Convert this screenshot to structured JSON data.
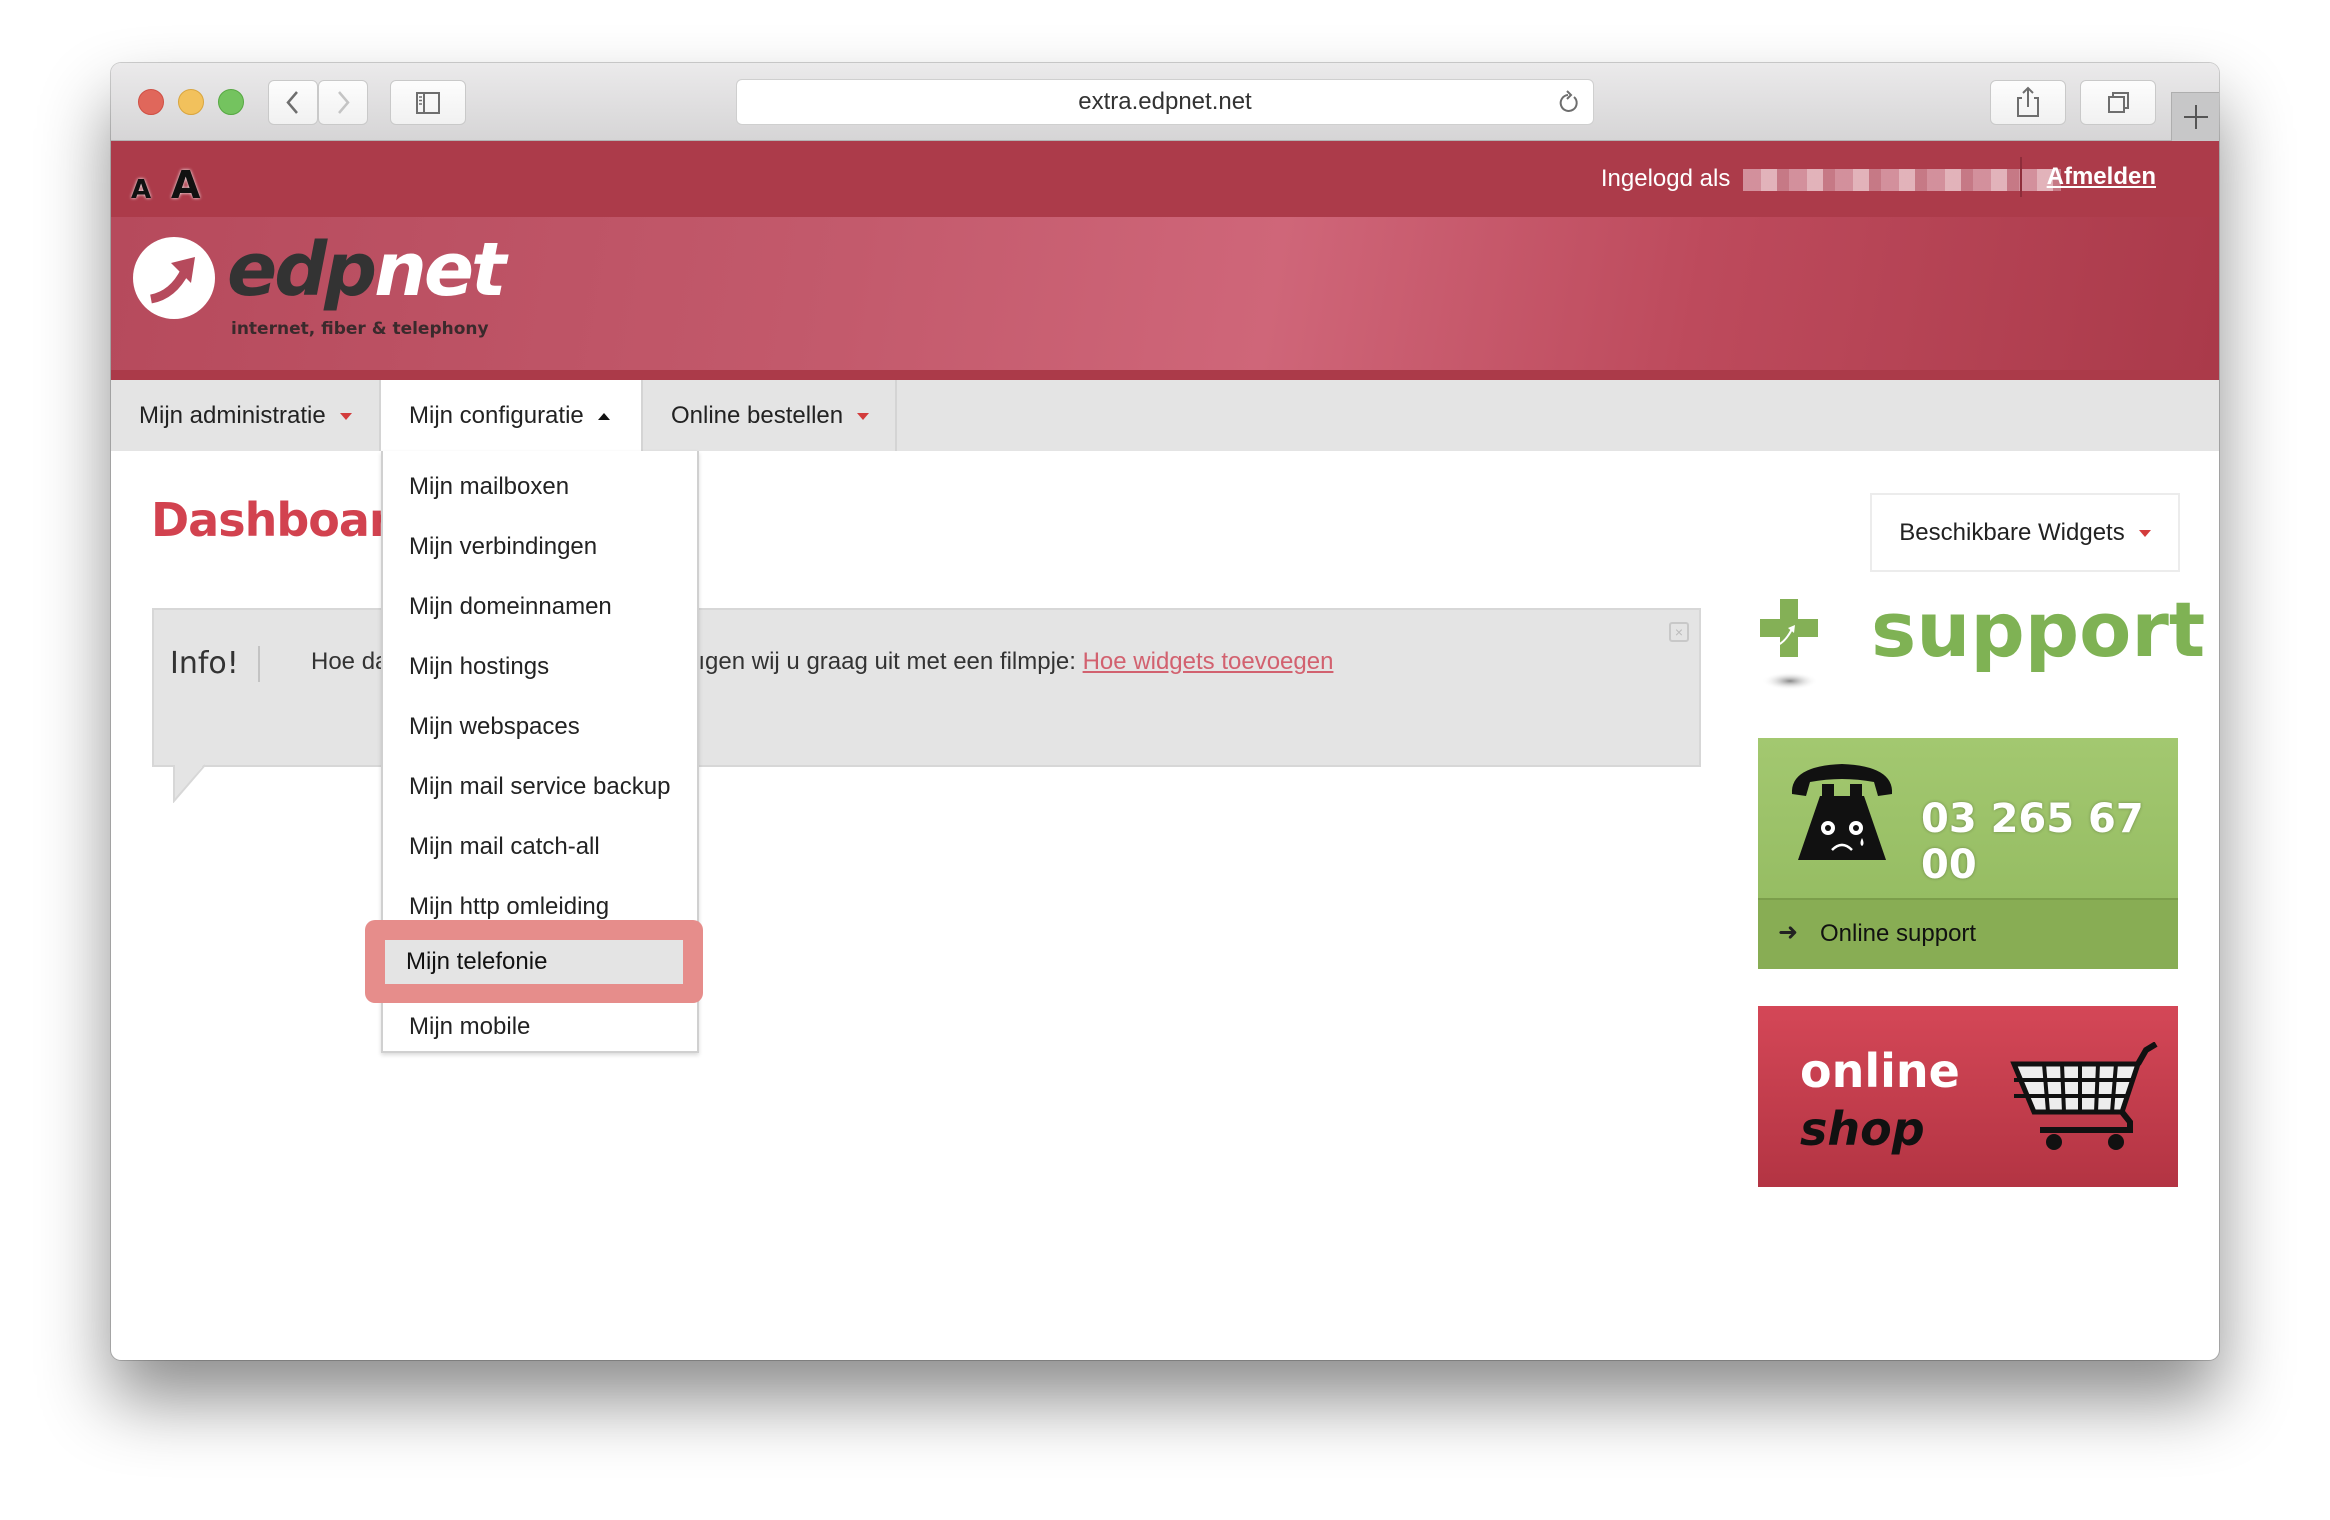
{
  "browser": {
    "url": "extra.edpnet.net",
    "traffic_lights": {
      "close": "#e0675b",
      "minimize": "#f2c15c",
      "zoom": "#74c35f"
    },
    "icons": [
      "back-icon",
      "forward-icon",
      "sidebar-icon",
      "reload-icon",
      "share-icon",
      "tabs-icon",
      "new-tab-icon"
    ]
  },
  "topbar": {
    "font_small": "A",
    "font_large": "A",
    "logged_in_label": "Ingelogd als",
    "logout": "Afmelden"
  },
  "header": {
    "logo_part1": "edp",
    "logo_part2": "net",
    "tagline": "internet, fiber & telephony"
  },
  "nav": {
    "tabs": [
      {
        "label": "Mijn administratie",
        "state": "closed"
      },
      {
        "label": "Mijn configuratie",
        "state": "open"
      },
      {
        "label": "Online bestellen",
        "state": "closed"
      }
    ]
  },
  "dropdown": {
    "items": [
      "Mijn mailboxen",
      "Mijn verbindingen",
      "Mijn domeinnamen",
      "Mijn hostings",
      "Mijn webspaces",
      "Mijn mail service backup",
      "Mijn mail catch-all",
      "Mijn http omleiding",
      "Mijn telefonie",
      "Mijn mobile"
    ],
    "highlighted": "Mijn telefonie"
  },
  "main": {
    "title": "Dashboard",
    "info": {
      "label": "Info!",
      "text_visible_start": "Hoe da",
      "text_visible_end": "ıgen wij u graag uit met een filmpje: ",
      "link": "Hoe widgets toevoegen"
    }
  },
  "sidebar": {
    "widgets_button": "Beschikbare Widgets",
    "support_title": "support",
    "phone_number": "03  265 67 00",
    "online_support": "Online support",
    "shop_line1": "online",
    "shop_line2": "shop"
  },
  "colors": {
    "brand_red": "#ac3b4a",
    "accent_red": "#d2424f",
    "support_green": "#9bc26a",
    "highlight": "#e68d8b"
  }
}
